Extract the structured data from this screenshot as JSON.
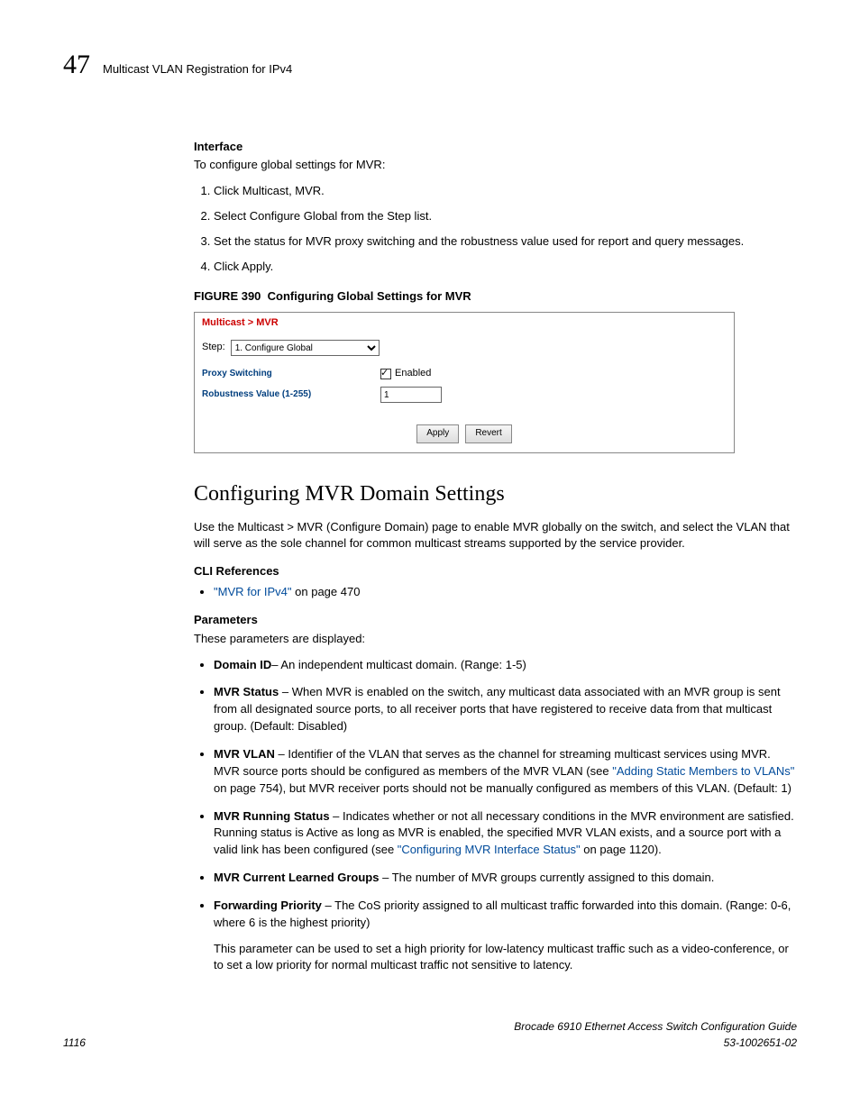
{
  "header": {
    "chapter_number": "47",
    "chapter_title": "Multicast VLAN Registration for IPv4"
  },
  "interface": {
    "heading": "Interface",
    "desc": "To configure global settings for MVR:",
    "steps": [
      "Click Multicast, MVR.",
      "Select Configure Global from the Step list.",
      "Set the status for MVR proxy switching and the robustness value used for report and query messages.",
      "Click Apply."
    ]
  },
  "figure": {
    "prefix": "FIGURE 390",
    "caption": "Configuring Global Settings for MVR"
  },
  "screenshot": {
    "breadcrumb_part1": "Multicast",
    "breadcrumb_sep": " > ",
    "breadcrumb_part2": "MVR",
    "step_label": "Step:",
    "step_value": "1. Configure Global",
    "proxy_label": "Proxy Switching",
    "enabled_label": "Enabled",
    "robust_label": "Robustness Value (1-255)",
    "robust_value": "1",
    "apply": "Apply",
    "revert": "Revert"
  },
  "section": {
    "title": "Configuring MVR Domain Settings",
    "intro": "Use the Multicast > MVR (Configure Domain) page to enable MVR globally on the switch, and select the VLAN that will serve as the sole channel for common multicast streams supported by the service provider."
  },
  "cli": {
    "heading": "CLI References",
    "link_text": "\"MVR for IPv4\"",
    "link_suffix": " on page 470"
  },
  "params": {
    "heading": "Parameters",
    "intro": "These parameters are displayed:",
    "items": {
      "domain_id_b": "Domain ID",
      "domain_id_t": "– An independent multicast domain. (Range: 1-5)",
      "mvr_status_b": "MVR Status",
      "mvr_status_t": " – When MVR is enabled on the switch, any multicast data associated with an MVR group is sent from all designated source ports, to all receiver ports that have registered to receive data from that multicast group. (Default: Disabled)",
      "mvr_vlan_b": "MVR VLAN",
      "mvr_vlan_t1": " – Identifier of the VLAN that serves as the channel for streaming multicast services using MVR. MVR source ports should be configured as members of the MVR VLAN (see ",
      "mvr_vlan_link": "\"Adding Static Members to VLANs\"",
      "mvr_vlan_t2": " on page 754), but MVR receiver ports should not be manually configured as members of this VLAN. (Default: 1)",
      "running_b": "MVR Running Status",
      "running_t1": " – Indicates whether or not all necessary conditions in the MVR environment are satisfied. Running status is Active as long as MVR is enabled, the specified MVR VLAN exists, and a source port with a valid link has been configured (see ",
      "running_link": "\"Configuring MVR Interface Status\"",
      "running_t2": " on page 1120).",
      "learned_b": "MVR Current Learned Groups",
      "learned_t": " – The number of MVR groups currently assigned to this domain.",
      "fwd_b": "Forwarding Priority",
      "fwd_t": " – The CoS priority assigned to all multicast traffic forwarded into this domain. (Range: 0-6, where 6 is the highest priority)",
      "fwd_note": "This parameter can be used to set a high priority for low-latency multicast traffic such as a video-conference, or to set a low priority for normal multicast traffic not sensitive to latency."
    }
  },
  "footer": {
    "page": "1116",
    "guide": "Brocade 6910 Ethernet Access Switch Configuration Guide",
    "doc": "53-1002651-02"
  }
}
